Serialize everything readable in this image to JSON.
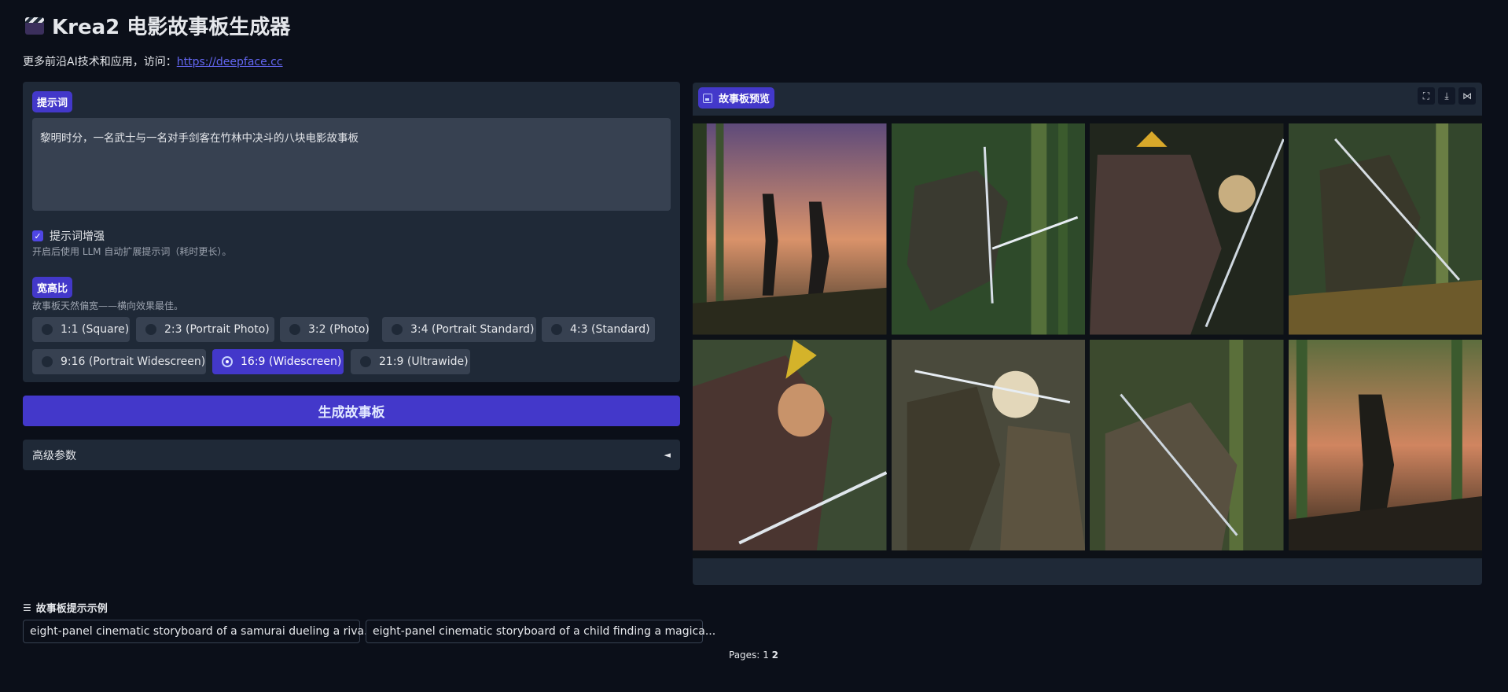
{
  "header": {
    "title": "Krea2 电影故事板生成器",
    "subline_prefix": "更多前沿AI技术和应用，访问：",
    "subline_link": "https://deepface.cc"
  },
  "prompt": {
    "label": "提示词",
    "value": "黎明时分，一名武士与一名对手剑客在竹林中决斗的八块电影故事板"
  },
  "enhance": {
    "label": "提示词增强",
    "checked": true,
    "info": "开启后使用 LLM 自动扩展提示词（耗时更长）。"
  },
  "aspect": {
    "label": "宽高比",
    "info": "故事板天然偏宽——横向效果最佳。",
    "options": [
      "1:1 (Square)",
      "2:3 (Portrait Photo)",
      "3:2 (Photo)",
      "3:4 (Portrait Standard)",
      "4:3 (Standard)",
      "9:16 (Portrait Widescreen)",
      "16:9 (Widescreen)",
      "21:9 (Ultrawide)"
    ],
    "selected": "16:9 (Widescreen)"
  },
  "generate_label": "生成故事板",
  "advanced": {
    "label": "高级参数",
    "arrow": "◄"
  },
  "preview": {
    "label": "故事板预览",
    "icons": [
      "fullscreen-icon",
      "download-icon",
      "share-icon"
    ]
  },
  "examples": {
    "title": "故事板提示示例",
    "items": [
      "eight-panel cinematic storyboard of a samurai dueling a riva...",
      "eight-panel cinematic storyboard of a child finding a magica..."
    ]
  },
  "pagination": {
    "label": "Pages:",
    "current": "1",
    "next": "2"
  },
  "colors": {
    "accent": "#4338ca",
    "background": "#0b0f19",
    "panel": "#1f2937"
  }
}
